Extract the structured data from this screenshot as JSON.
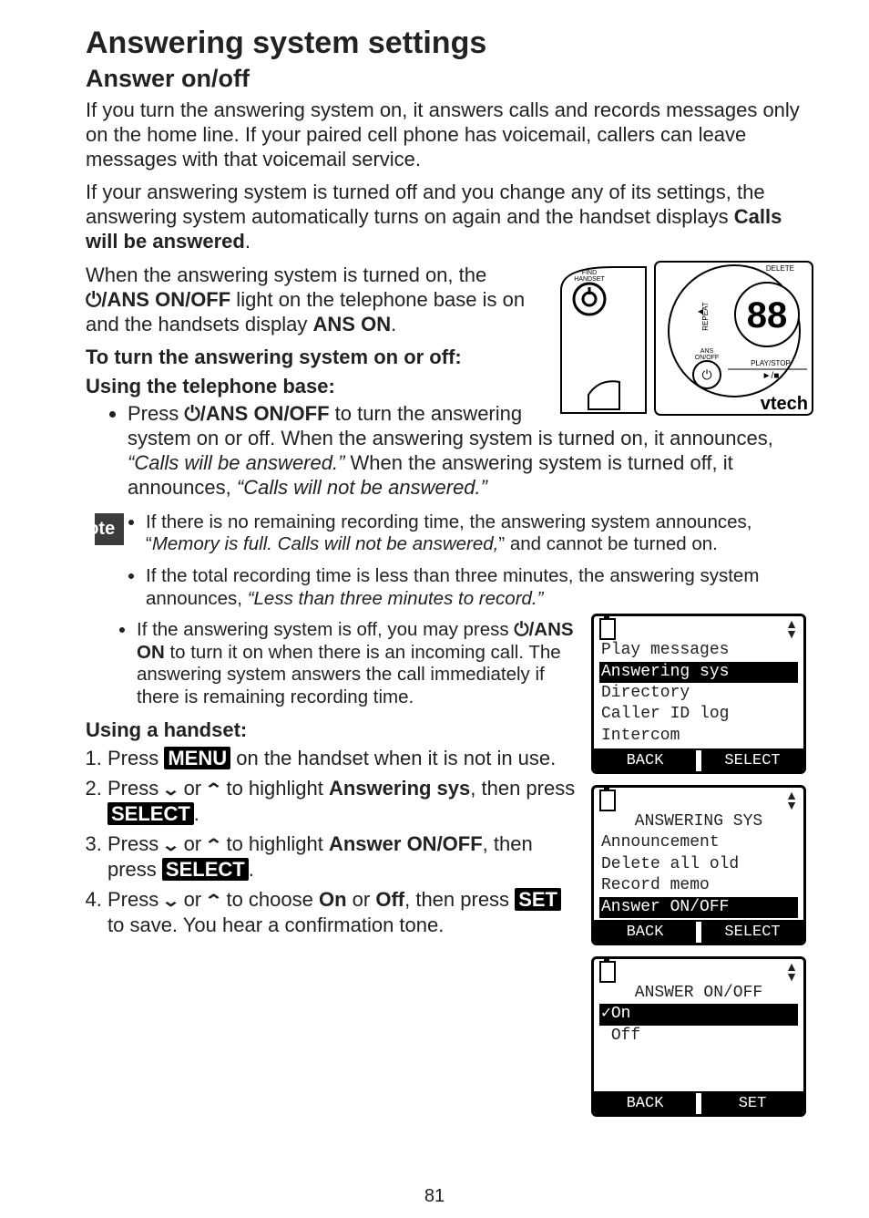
{
  "page_number": "81",
  "title": "Answering system settings",
  "subtitle": "Answer on/off",
  "para1_a": "If you turn the answering system on, it answers calls and records messages only on the home line. If your paired cell phone has voicemail, callers can leave messages with that voicemail service.",
  "para2_a": "If your answering system is turned off and you change any of its settings, the answering system automatically turns on again and the handset displays ",
  "para2_bold": "Calls will be answered",
  "para2_tail": ".",
  "para3_a": "When the answering system is turned on, the ",
  "para3_icon_label": "/ANS ON/OFF",
  "para3_b": " light on the telephone base is on and the handsets display ",
  "para3_bold2": "ANS ON",
  "para3_tail": ".",
  "heading_onoff": "To turn the answering system on or off:",
  "heading_base": "Using the telephone base:",
  "base_bullet_a": "Press ",
  "base_bullet_icon": "/ANS ON/OFF",
  "base_bullet_b": " to turn the answering system on or off. When the answering system is turned on, it announces, ",
  "base_bullet_q1": "“Calls will be answered.”",
  "base_bullet_c": "  When the answering system is turned off, it announces, ",
  "base_bullet_q2": "“Calls will not be answered.”",
  "note_label": "note",
  "note1_a": "If there is no remaining recording time, the answering system announces, “",
  "note1_it": "Memory is full. Calls will not be answered,",
  "note1_b": "” and cannot be turned on.",
  "note2_a": "If the total recording time is less than three minutes, the answering system announces, ",
  "note2_it": "“Less than three minutes to record.”",
  "note3_a": "If the answering system is off, you may press ",
  "note3_icon": "/ANS ON",
  "note3_b": " to turn it on when there is an incoming call. The answering system answers the call immediately if there is remaining recording time.",
  "heading_handset": "Using a handset:",
  "step1_a": "Press ",
  "step1_inv": "MENU",
  "step1_b": " on the handset when it is not in use.",
  "step2_a": "Press ",
  "step2_b": " or ",
  "step2_c": " to highlight ",
  "step2_bold": "Answering sys",
  "step2_d": ", then press ",
  "step2_inv": "SELECT",
  "step2_tail": ".",
  "step3_a": "Press ",
  "step3_b": " or ",
  "step3_c": " to highlight ",
  "step3_bold": "Answer ON/OFF",
  "step3_d": ", then press ",
  "step3_inv": "SELECT",
  "step3_tail": ".",
  "step4_a": "Press ",
  "step4_b": " or ",
  "step4_c": " to choose ",
  "step4_bold1": "On",
  "step4_mid": " or ",
  "step4_bold2": "Off",
  "step4_d": ", then press ",
  "step4_inv": "SET",
  "step4_e": " to save. You hear a confirmation tone.",
  "screen1": {
    "l1": "Play messages",
    "l2": "Answering sys",
    "l3": "Directory",
    "l4": "Caller ID log",
    "l5": "Intercom",
    "sk_left": "BACK",
    "sk_right": "SELECT"
  },
  "screen2": {
    "title": "ANSWERING SYS",
    "l1": "Announcement",
    "l2": "Delete all old",
    "l3": "Record memo",
    "l4": "Answer ON/OFF",
    "sk_left": "BACK",
    "sk_right": "SELECT"
  },
  "screen3": {
    "title": "ANSWER ON/OFF",
    "l1": "On",
    "l2": "Off",
    "sk_left": "BACK",
    "sk_right": "SET"
  },
  "base_illus": {
    "find_handset": "FIND\nHANDSET",
    "ans_onoff": "ANS\nON/OFF",
    "repeat": "REPEAT",
    "delete": "DELETE",
    "playstop": "PLAY/STOP",
    "counter": "88",
    "brand": "vtech"
  }
}
